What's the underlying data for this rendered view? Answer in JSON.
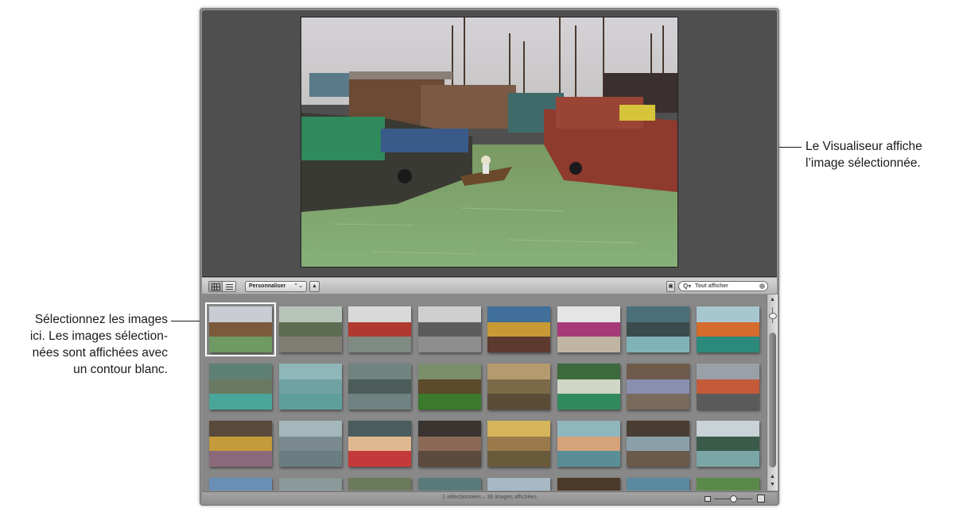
{
  "callouts": {
    "viewer": [
      "Le Visualiseur affiche",
      "l’image sélectionnée."
    ],
    "browser": [
      "Sélectionnez les images",
      "ici. Les images sélection-",
      "nées sont affichées avec",
      "un contour blanc."
    ]
  },
  "toolbar": {
    "view_buttons": [
      "grid-view",
      "list-view"
    ],
    "sort_popup": "Personnaliser",
    "sort_popup_arrows": "⌃⌄",
    "sort_direction": "▲",
    "search_placeholder": "Tout afficher",
    "search_icon_glyph": "Q▾"
  },
  "browser": {
    "thumbnails": [
      {
        "sky": "#c9ccd3",
        "mid": "#7b5a3c",
        "low": "#6f9a63",
        "selected": true
      },
      {
        "sky": "#b7c4b9",
        "mid": "#5c6d52",
        "low": "#7f7c74",
        "selected": false
      },
      {
        "sky": "#d9d9d9",
        "mid": "#b13a30",
        "low": "#7d8b82",
        "selected": false
      },
      {
        "sky": "#cfcfcf",
        "mid": "#5c5c5c",
        "low": "#8e8e8e",
        "selected": false
      },
      {
        "sky": "#3f6f9a",
        "mid": "#c79a36",
        "low": "#5c3a2e",
        "selected": false
      },
      {
        "sky": "#e5e5e5",
        "mid": "#a63a78",
        "low": "#c0b5a2",
        "selected": false
      },
      {
        "sky": "#4a6f78",
        "mid": "#3a4c4c",
        "low": "#7fb3b8",
        "selected": false
      },
      {
        "sky": "#a7c7cf",
        "mid": "#d66b2e",
        "low": "#2c8a7c",
        "selected": false
      },
      {
        "sky": "#5e7f73",
        "mid": "#6a7a62",
        "low": "#4aa69a",
        "selected": false
      },
      {
        "sky": "#8fb6b9",
        "mid": "#6fa3a3",
        "low": "#5e9f9c",
        "selected": false
      },
      {
        "sky": "#6f8380",
        "mid": "#4c5c5a",
        "low": "#6e8282",
        "selected": false
      },
      {
        "sky": "#7a8f6a",
        "mid": "#5c4a2a",
        "low": "#3a7a2a",
        "selected": false
      },
      {
        "sky": "#b59a6e",
        "mid": "#7a6a48",
        "low": "#5a4c36",
        "selected": false
      },
      {
        "sky": "#3c6a3c",
        "mid": "#cfd6c6",
        "low": "#2f8a5c",
        "selected": false
      },
      {
        "sky": "#6f5a4a",
        "mid": "#8a8fb0",
        "low": "#7a6a5c",
        "selected": false
      },
      {
        "sky": "#9aa0a8",
        "mid": "#c45a3a",
        "low": "#5a5a5a",
        "selected": false
      },
      {
        "sky": "#5a4a3c",
        "mid": "#c49a3a",
        "low": "#8a6a7a",
        "selected": false
      },
      {
        "sky": "#a4b8bc",
        "mid": "#7a8a8e",
        "low": "#6a7e82",
        "selected": false
      },
      {
        "sky": "#4a5c5c",
        "mid": "#e0b890",
        "low": "#c43a3a",
        "selected": false
      },
      {
        "sky": "#3a3430",
        "mid": "#8a6a56",
        "low": "#5c4a3e",
        "selected": false
      },
      {
        "sky": "#d6b45a",
        "mid": "#9a7a4a",
        "low": "#6a5a3c",
        "selected": false
      },
      {
        "sky": "#8fb6bd",
        "mid": "#d6a27a",
        "low": "#5a8e96",
        "selected": false
      },
      {
        "sky": "#4a3e34",
        "mid": "#8aa0a8",
        "low": "#6a5a4a",
        "selected": false
      },
      {
        "sky": "#c9d2d6",
        "mid": "#3a5a4a",
        "low": "#7aa6a6",
        "selected": false
      },
      {
        "sky": "#6a90b8",
        "mid": "#a8b8c4",
        "low": "#5c7a8a",
        "selected": false
      },
      {
        "sky": "#8a9a9a",
        "mid": "#4a5a4a",
        "low": "#9aa69a",
        "selected": false
      },
      {
        "sky": "#6a7a5a",
        "mid": "#b6a26a",
        "low": "#7a6a4a",
        "selected": false
      },
      {
        "sky": "#5a7a7a",
        "mid": "#4a6a6a",
        "low": "#6a8a8a",
        "selected": false
      },
      {
        "sky": "#a6b8c4",
        "mid": "#c4b8a6",
        "low": "#7a8a96",
        "selected": false
      },
      {
        "sky": "#4a3a2a",
        "mid": "#c4a06a",
        "low": "#6a5a3a",
        "selected": false
      },
      {
        "sky": "#5a8aa0",
        "mid": "#4a7a96",
        "low": "#3a6a86",
        "selected": false
      },
      {
        "sky": "#5a8a4a",
        "mid": "#c4b06a",
        "low": "#6a5a3a",
        "selected": false
      }
    ]
  },
  "scrollbar": {
    "up": "▲",
    "down": "▼"
  },
  "statusbar": {
    "status_text": "1 sélectionnées – 36 images affichées"
  }
}
